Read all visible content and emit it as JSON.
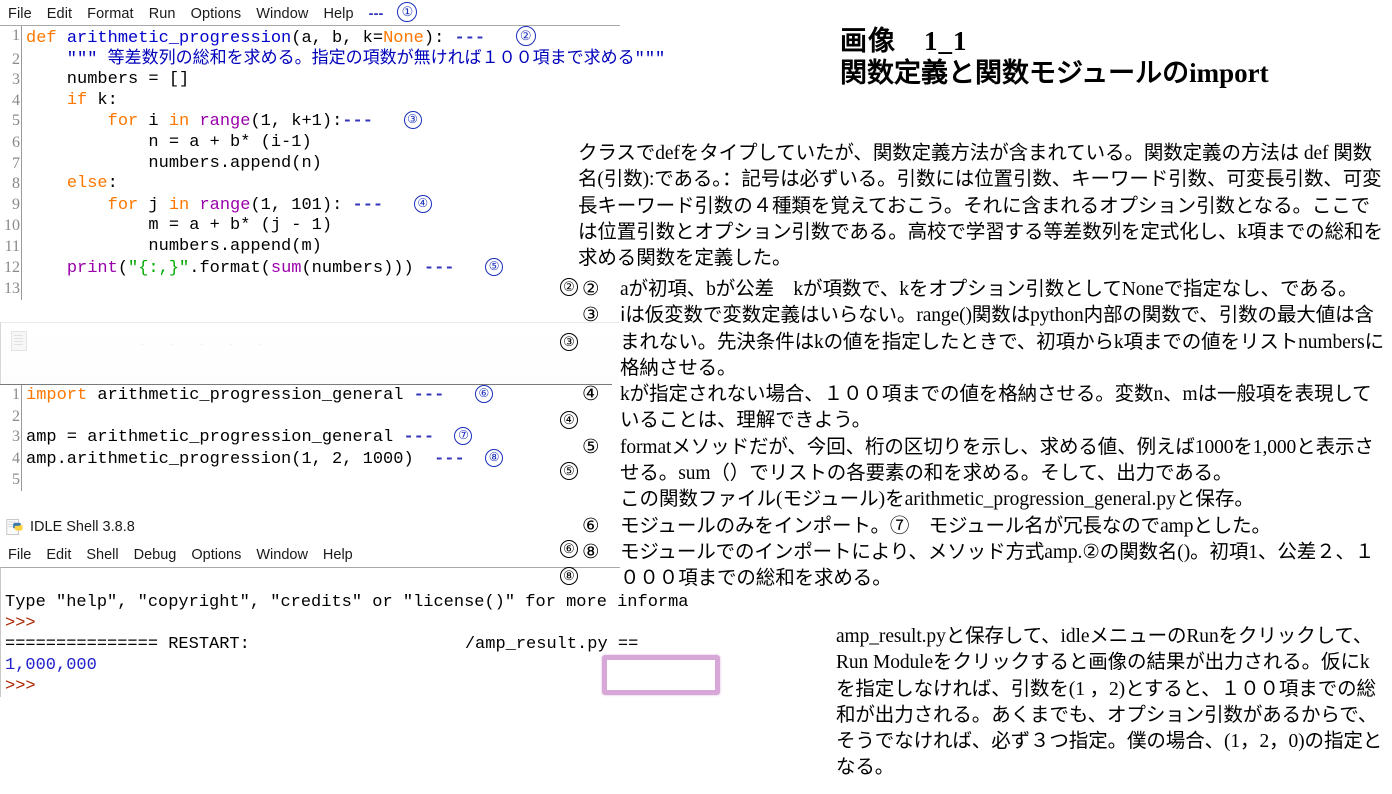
{
  "editor1": {
    "menu": [
      "File",
      "Edit",
      "Format",
      "Run",
      "Options",
      "Window",
      "Help"
    ],
    "menu_marker_dashes": "---",
    "menu_marker_circle": "①",
    "lines": [
      {
        "n": "1",
        "text": "def arithmetic_progression(a, b, k=None): ---    ②"
      },
      {
        "n": "2",
        "text": "    \"\"\" 等差数列の総和を求める。指定の項数が無ければ１００項まで求める\"\"\""
      },
      {
        "n": "3",
        "text": "    numbers = []"
      },
      {
        "n": "4",
        "text": "    if k:"
      },
      {
        "n": "5",
        "text": "        for i in range(1, k+1):---   ③"
      },
      {
        "n": "6",
        "text": "            n = a + b* (i-1)"
      },
      {
        "n": "7",
        "text": "            numbers.append(n)"
      },
      {
        "n": "8",
        "text": "    else:"
      },
      {
        "n": "9",
        "text": "        for j in range(1, 101): ---   ④"
      },
      {
        "n": "10",
        "text": "            m = a + b* (j - 1)"
      },
      {
        "n": "11",
        "text": "            numbers.append(m)"
      },
      {
        "n": "12",
        "text": "    print(\"{:,}\".format(sum(numbers))) ---   ⑤"
      },
      {
        "n": "13",
        "text": ""
      }
    ]
  },
  "editor2": {
    "lines": [
      {
        "n": "1",
        "text": "import arithmetic_progression_general ---   ⑥"
      },
      {
        "n": "2",
        "text": ""
      },
      {
        "n": "3",
        "text": "amp = arithmetic_progression_general ---   ⑦"
      },
      {
        "n": "4",
        "text": "amp.arithmetic_progression(1, 2, 1000)  ---   ⑧"
      },
      {
        "n": "5",
        "text": ""
      }
    ]
  },
  "shell": {
    "title": "IDLE Shell 3.8.8",
    "menu": [
      "File",
      "Edit",
      "Shell",
      "Debug",
      "Options",
      "Window",
      "Help"
    ],
    "line_type": "Type \"help\", \"copyright\", \"credits\" or \"license()\" for more informa",
    "prompt1": ">>>",
    "restart": "=============== RESTART:",
    "restart_path": "/amp_result.py",
    "restart_tail": "==",
    "result": "1,000,000",
    "prompt2": ">>>"
  },
  "right": {
    "title_line1": "画像　1_1",
    "title_line2": "関数定義と関数モジュールのimport",
    "paragraph1": "クラスでdefをタイプしていたが、関数定義方法が含まれている。関数定義の方法は def 関数名(引数):である。：記号は必ずいる。引数には位置引数、キーワード引数、可変長引数、可変長キーワード引数の４種類を覚えておこう。それに含まれるオプション引数となる。ここでは位置引数とオプション引数である。高校で学習する等差数列を定式化し、k項までの総和を求める関数を定義した。",
    "notes": [
      {
        "num": "②",
        "body": "aが初項、bが公差　kが項数で、kをオプション引数としてNoneで指定なし、である。"
      },
      {
        "num": "③",
        "body": "ⅰは仮変数で変数定義はいらない。range()関数はpython内部の関数で、引数の最大値は含まれない。先決条件はkの値を指定したときで、初項からk項までの値をリストnumbersに格納させる。"
      },
      {
        "num": "④",
        "body": "kが指定されない場合、１００項までの値を格納させる。変数n、mは一般項を表現していることは、理解できよう。"
      },
      {
        "num": "⑤",
        "body": "formatメソッドだが、今回、桁の区切りを示し、求める値、例えば1000を1,000と表示させる。sum（）でリストの各要素の和を求める。そして、出力である。"
      }
    ],
    "note5_continuation": "この関数ファイル(モジュール)をarithmetic_progression_general.pyと保存。",
    "note6": {
      "num": "⑥",
      "body": "モジュールのみをインポート。⑦　モジュール名が冗長なのでampとした。"
    },
    "note8": {
      "num": "⑧",
      "body": "モジュールでのインポートにより、メソッド方式amp.②の関数名()。初項1、公差２、１０００項までの総和を求める。"
    },
    "paragraph2": "amp_result.pyと保存して、idleメニューのRunをクリックして、Run Moduleをクリックすると画像の結果が出力される。仮にkを指定しなければ、引数を(1 ，2)とすると、１００項までの総和が出力される。あくまでも、オプション引数があるからで、そうでなければ、必ず３つ指定。僕の場合、(1，2，0)の指定となる。",
    "margin_index": [
      "②",
      "③",
      "④",
      "⑤",
      "⑥",
      "⑧"
    ]
  },
  "colors": {
    "keyword": "#ff7700",
    "definition": "#0000cc",
    "builtin": "#9900aa",
    "string": "#00aa00",
    "docstring": "#0000bb",
    "prompt": "#aa2200",
    "output": "#2222cc",
    "marker_blue": "#1a2fbb",
    "highlighter": "#c785c7"
  }
}
